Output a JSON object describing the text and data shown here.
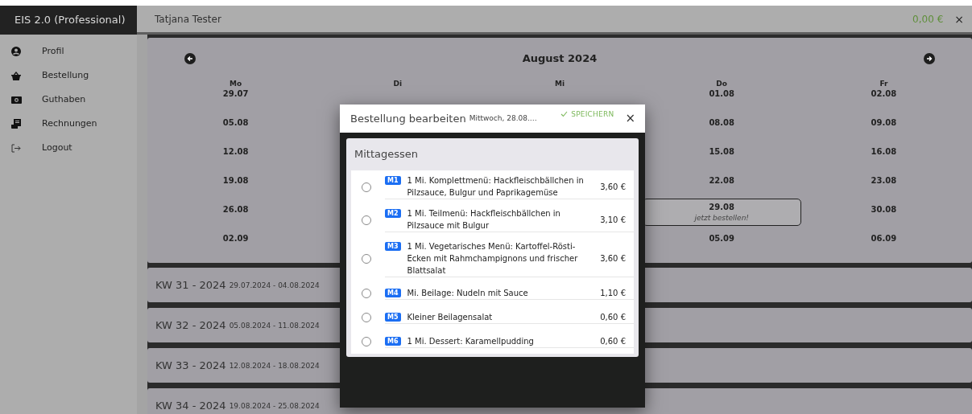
{
  "app": {
    "title": "EIS 2.0 (Professional)",
    "user": "Tatjana Tester",
    "balance": "0,00 €",
    "close": "×"
  },
  "sidebar": {
    "items": [
      {
        "kind": "profile",
        "label": "Profil"
      },
      {
        "kind": "basket",
        "label": "Bestellung"
      },
      {
        "kind": "money",
        "label": "Guthaben"
      },
      {
        "kind": "invoice",
        "label": "Rechnungen"
      },
      {
        "kind": "logout",
        "label": "Logout"
      }
    ]
  },
  "calendar": {
    "title": "August 2024",
    "weekdays": [
      "Mo",
      "Di",
      "Mi",
      "Do",
      "Fr"
    ],
    "rows": [
      {
        "mo": {
          "date": "29.07",
          "highlighted": false
        },
        "do": {
          "date": "01.08",
          "highlighted": false
        },
        "fr": {
          "date": "02.08",
          "highlighted": false
        }
      },
      {
        "mo": {
          "date": "05.08",
          "highlighted": false
        },
        "do": {
          "date": "08.08",
          "highlighted": false
        },
        "fr": {
          "date": "09.08",
          "highlighted": false
        }
      },
      {
        "mo": {
          "date": "12.08",
          "highlighted": false
        },
        "do": {
          "date": "15.08",
          "highlighted": false
        },
        "fr": {
          "date": "16.08",
          "highlighted": false
        }
      },
      {
        "mo": {
          "date": "19.08",
          "highlighted": false
        },
        "do": {
          "date": "22.08",
          "highlighted": false
        },
        "fr": {
          "date": "23.08",
          "highlighted": false
        }
      },
      {
        "mo": {
          "date": "26.08",
          "highlighted": false
        },
        "do": {
          "date": "29.08",
          "highlighted": true,
          "note": "jetzt bestellen!"
        },
        "fr": {
          "date": "30.08",
          "highlighted": false
        }
      },
      {
        "mo": {
          "date": "02.09",
          "highlighted": false
        },
        "do": {
          "date": "05.09",
          "highlighted": false
        },
        "fr": {
          "date": "06.09",
          "highlighted": false
        }
      }
    ]
  },
  "weeks": [
    {
      "title": "KW 31 - 2024",
      "range": "29.07.2024 - 04.08.2024"
    },
    {
      "title": "KW 32 - 2024",
      "range": "05.08.2024 - 11.08.2024"
    },
    {
      "title": "KW 33 - 2024",
      "range": "12.08.2024 - 18.08.2024"
    },
    {
      "title": "KW 34 - 2024",
      "range": "19.08.2024 - 25.08.2024"
    }
  ],
  "dialog": {
    "title": "Bestellung bearbeiten",
    "subtitle": "Mittwoch, 28.08.…",
    "save": "SPEICHERN",
    "close": "×",
    "section": "Mittagessen",
    "meals": [
      {
        "code": "M1",
        "name": "1 Mi. Komplettmenü: Hackfleischbällchen in Pilzsauce, Bulgur und Paprikagemüse",
        "price": "3,60 €",
        "selected": false
      },
      {
        "code": "M2",
        "name": "1 Mi. Teilmenü: Hackfleischbällchen in Pilzsauce mit Bulgur",
        "price": "3,10 €",
        "selected": false
      },
      {
        "code": "M3",
        "name": "1 Mi. Vegetarisches Menü: Kartoffel-Rösti-Ecken mit Rahmchampignons und frischer Blattsalat",
        "price": "3,60 €",
        "selected": false
      },
      {
        "code": "M4",
        "name": "Mi. Beilage: Nudeln mit Sauce",
        "price": "1,10 €",
        "selected": false
      },
      {
        "code": "M5",
        "name": "Kleiner Beilagensalat",
        "price": "0,60 €",
        "selected": false
      },
      {
        "code": "M6",
        "name": "1 Mi. Dessert: Karamellpudding",
        "price": "0,60 €",
        "selected": false
      }
    ]
  }
}
